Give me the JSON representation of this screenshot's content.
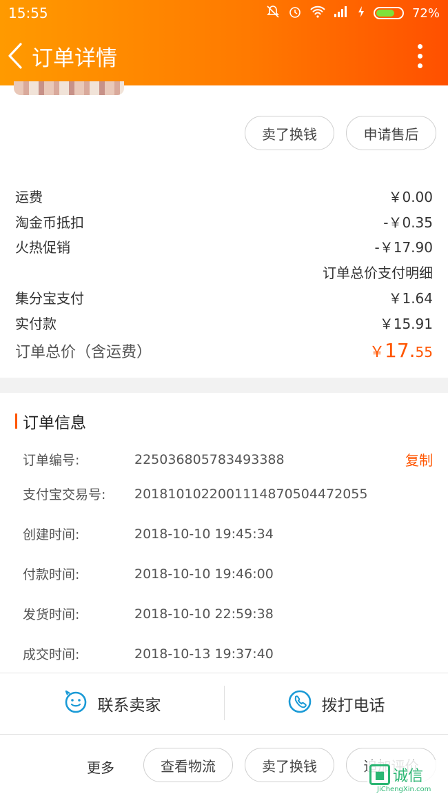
{
  "status_bar": {
    "time": "15:55",
    "battery_percent": "72%",
    "battery_level": 0.72,
    "icons": [
      "mute-icon",
      "alarm-icon",
      "wifi-icon",
      "signal-icon",
      "charging-icon",
      "battery-icon"
    ]
  },
  "header": {
    "title": "订单详情",
    "colors": {
      "start": "#ff9a00",
      "end": "#ff5000"
    }
  },
  "actions_top": {
    "sell_label": "卖了换钱",
    "after_sale_label": "申请售后"
  },
  "fees": {
    "rows": [
      {
        "label": "运费",
        "value": "￥0.00"
      },
      {
        "label": "淘金币抵扣",
        "value": "-￥0.35"
      },
      {
        "label": "火热促销",
        "value": "-￥17.90"
      }
    ],
    "detail_link": "订单总价支付明细",
    "rows2": [
      {
        "label": "集分宝支付",
        "value": "￥1.64"
      },
      {
        "label": "实付款",
        "value": "￥15.91"
      }
    ],
    "total_label": "订单总价（含运费）",
    "total_symbol": "￥",
    "total_int": "17.",
    "total_dec": "55"
  },
  "order_info": {
    "title": "订单信息",
    "copy_label": "复制",
    "rows": [
      {
        "label": "订单编号:",
        "value": "225036805783493388"
      },
      {
        "label": "支付宝交易号:",
        "value": "2018101022001114870504472055"
      },
      {
        "label": "创建时间:",
        "value": "2018-10-10 19:45:34"
      },
      {
        "label": "付款时间:",
        "value": "2018-10-10 19:46:00"
      },
      {
        "label": "发货时间:",
        "value": "2018-10-10 22:59:38"
      },
      {
        "label": "成交时间:",
        "value": "2018-10-13 19:37:40"
      }
    ]
  },
  "contact": {
    "seller_label": "联系卖家",
    "call_label": "拨打电话"
  },
  "bottom": {
    "more_label": "更多",
    "logistics_label": "查看物流",
    "sell_label": "卖了换钱",
    "review_label": "追加评价"
  },
  "watermark": {
    "text": "诚信",
    "url": "JiChengXin.com"
  },
  "accent_color": "#ff5500"
}
